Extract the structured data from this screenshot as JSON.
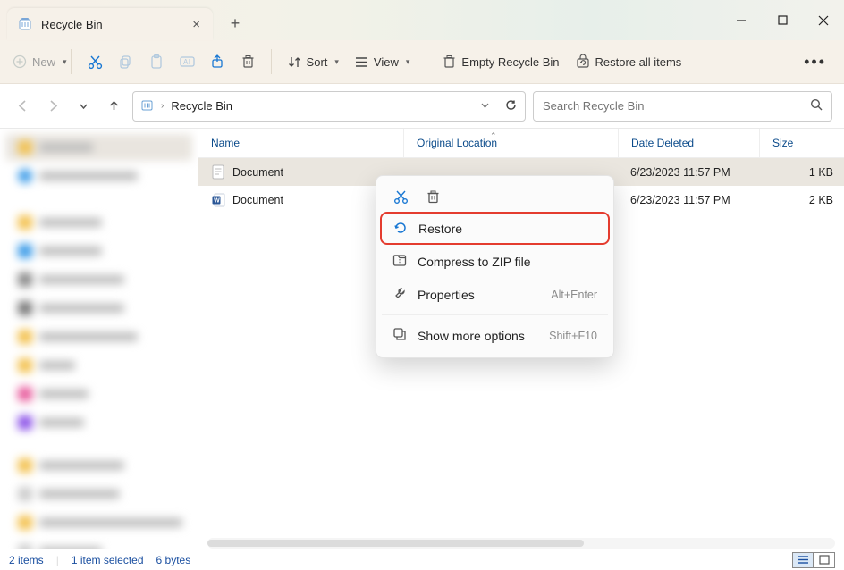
{
  "window": {
    "title": "Recycle Bin"
  },
  "toolbar": {
    "new": "New",
    "sort": "Sort",
    "view": "View",
    "empty": "Empty Recycle Bin",
    "restore_all": "Restore all items"
  },
  "nav": {
    "path": "Recycle Bin",
    "search_placeholder": "Search Recycle Bin"
  },
  "columns": {
    "name": "Name",
    "orig": "Original Location",
    "date": "Date Deleted",
    "size": "Size"
  },
  "rows": [
    {
      "name": "Document",
      "type": "txt",
      "orig": "",
      "date": "6/23/2023 11:57 PM",
      "size": "1 KB"
    },
    {
      "name": "Document",
      "type": "docx",
      "orig": "",
      "date": "6/23/2023 11:57 PM",
      "size": "2 KB"
    }
  ],
  "context_menu": {
    "restore": "Restore",
    "compress": "Compress to ZIP file",
    "properties": "Properties",
    "properties_shortcut": "Alt+Enter",
    "more": "Show more options",
    "more_shortcut": "Shift+F10"
  },
  "status": {
    "count": "2 items",
    "selection": "1 item selected",
    "bytes": "6 bytes"
  }
}
